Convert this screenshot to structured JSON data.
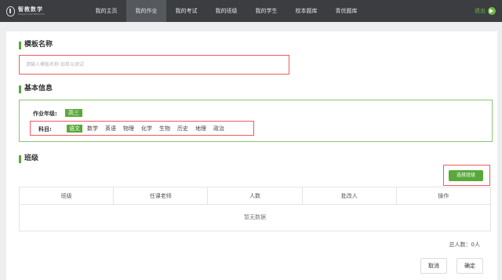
{
  "logo": {
    "title": "智教数学",
    "subtitle": "ZHIJIAO MATHEMATICS"
  },
  "nav": {
    "items": [
      {
        "label": "我的主页"
      },
      {
        "label": "我的作业"
      },
      {
        "label": "我的考试"
      },
      {
        "label": "我的班级"
      },
      {
        "label": "我的学生"
      },
      {
        "label": "校本题库"
      },
      {
        "label": "青优题库"
      }
    ],
    "active": "我的作业",
    "logout_label": "退出",
    "logout_icon": "logout-arrow-icon"
  },
  "template": {
    "section_title": "模板名称",
    "input_value": "",
    "input_placeholder": "请输入模板名称 如单元测试"
  },
  "basic_info": {
    "section_title": "基本信息",
    "grade_label": "作业年级:",
    "grade_value": "高三",
    "subject_label": "科目:",
    "subjects": [
      "语文",
      "数学",
      "英语",
      "物理",
      "化学",
      "生物",
      "历史",
      "地理",
      "政治"
    ],
    "selected_subject": "语文"
  },
  "classes": {
    "section_title": "班级",
    "select_button": "选择班级",
    "columns": [
      "班级",
      "任课老师",
      "人数",
      "批改人",
      "操作"
    ],
    "empty_text": "暂无数据",
    "total_text": "总人数：0人"
  },
  "actions": {
    "cancel": "取消",
    "confirm": "确定"
  },
  "colors": {
    "accent": "#58a93a",
    "nav_bg": "#3b3d40",
    "highlight_border": "#f15a5f"
  }
}
